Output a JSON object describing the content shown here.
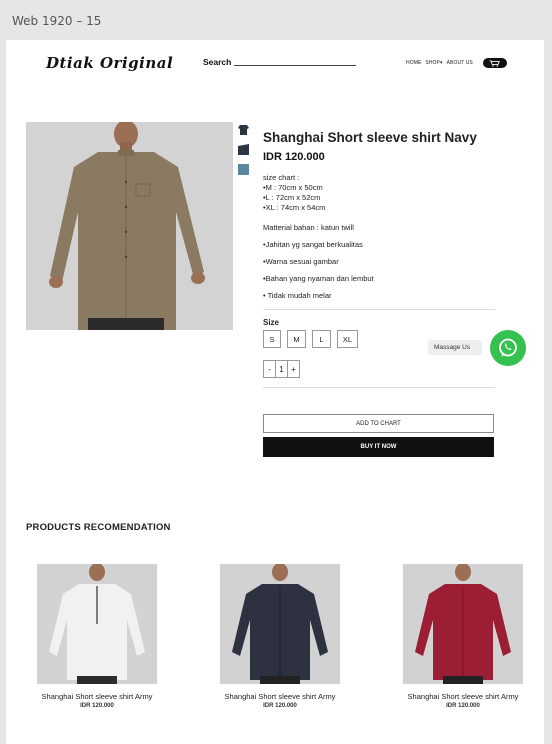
{
  "frame": {
    "title": "Web 1920 – 15"
  },
  "header": {
    "logo": "Dtiak Original",
    "search_label": "Search",
    "nav": [
      "HOME",
      "SHOP▾",
      "ABOUT US"
    ]
  },
  "product": {
    "title": "Shanghai Short sleeve shirt Navy",
    "price": "IDR 120.000",
    "size_chart": [
      "size chart :",
      "•M : 70cm x 50cm",
      "•L  : 72cm x 52cm",
      "•XL : 74cm x 54cm"
    ],
    "material": [
      "Matterial bahan : katun twill",
      "•Jahitan yg sangat berkualitas",
      "•Warna sesuai gambar",
      "•Bahan yang nyaman dan lembut",
      "• Tidak mudah melar"
    ],
    "size_label": "Size",
    "sizes": [
      "S",
      "M",
      "L",
      "XL"
    ],
    "qty": {
      "minus": "-",
      "value": "1",
      "plus": "+"
    },
    "thumb_colors": [
      "#2c3440",
      "#2e3645",
      "#5b87a0"
    ],
    "shirt_color": "#8a7a62"
  },
  "actions": {
    "add_to_cart": "ADD TO CHART",
    "buy_now": "BUY IT NOW",
    "message_us": "Massage Us"
  },
  "recommendations": {
    "title": "PRODUCTS RECOMENDATION",
    "items": [
      {
        "name": "Shanghai Short sleeve shirt Army",
        "price": "IDR 120.000",
        "color": "#f1f1f1"
      },
      {
        "name": "Shanghai Short sleeve shirt Army",
        "price": "IDR 120.000",
        "color": "#2e3140"
      },
      {
        "name": "Shanghai Short sleeve shirt Army",
        "price": "IDR 120.000",
        "color": "#9c1e35"
      }
    ]
  }
}
